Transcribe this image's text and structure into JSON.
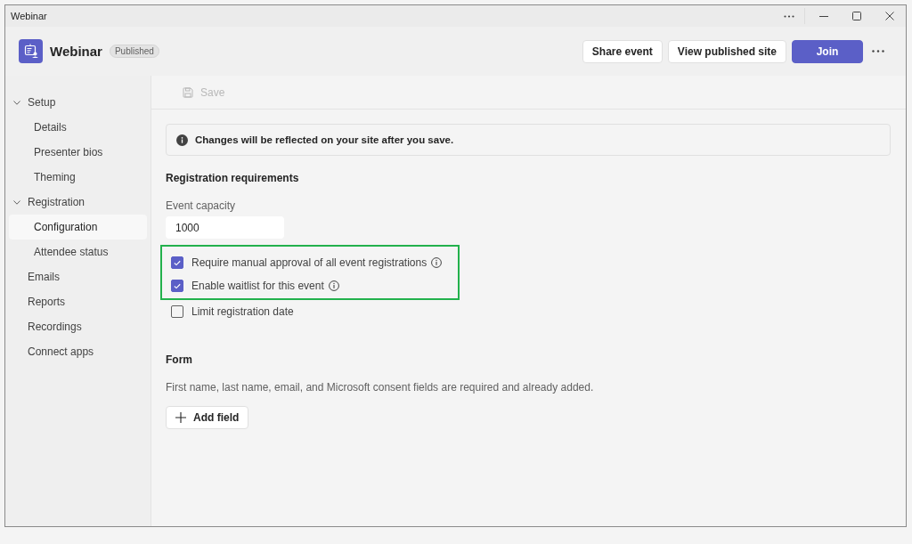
{
  "window": {
    "title": "Webinar"
  },
  "header": {
    "title": "Webinar",
    "status_badge": "Published",
    "buttons": [
      {
        "label": "Share event",
        "kind": "secondary"
      },
      {
        "label": "View published site",
        "kind": "secondary"
      },
      {
        "label": "Join",
        "kind": "primary"
      }
    ]
  },
  "sidebar": {
    "items": [
      {
        "label": "Setup",
        "selected": false,
        "expanded": true,
        "children": [
          {
            "label": "Details",
            "selected": false
          },
          {
            "label": "Presenter bios",
            "selected": false
          },
          {
            "label": "Theming",
            "selected": false
          }
        ]
      },
      {
        "label": "Registration",
        "selected": false,
        "expanded": true,
        "children": [
          {
            "label": "Configuration",
            "selected": true
          },
          {
            "label": "Attendee status",
            "selected": false
          }
        ]
      },
      {
        "label": "Emails",
        "selected": false
      },
      {
        "label": "Reports",
        "selected": false
      },
      {
        "label": "Recordings",
        "selected": false
      },
      {
        "label": "Connect apps",
        "selected": false
      }
    ]
  },
  "toolbar": {
    "save": {
      "label": "Save",
      "disabled": true
    }
  },
  "info_bar": {
    "text": "Changes will be reflected on your site after you save."
  },
  "registration": {
    "heading": "Registration requirements",
    "capacity": {
      "label": "Event capacity",
      "value": "1000"
    },
    "options": [
      {
        "label": "Require manual approval of all event registrations",
        "checked": true,
        "info": true,
        "highlighted": true
      },
      {
        "label": "Enable waitlist for this event",
        "checked": true,
        "info": true,
        "highlighted": true
      },
      {
        "label": "Limit registration date",
        "checked": false,
        "info": false,
        "highlighted": false
      }
    ]
  },
  "form": {
    "heading": "Form",
    "description": "First name, last name, email, and Microsoft consent fields are required and already added.",
    "add_button": "Add field"
  }
}
